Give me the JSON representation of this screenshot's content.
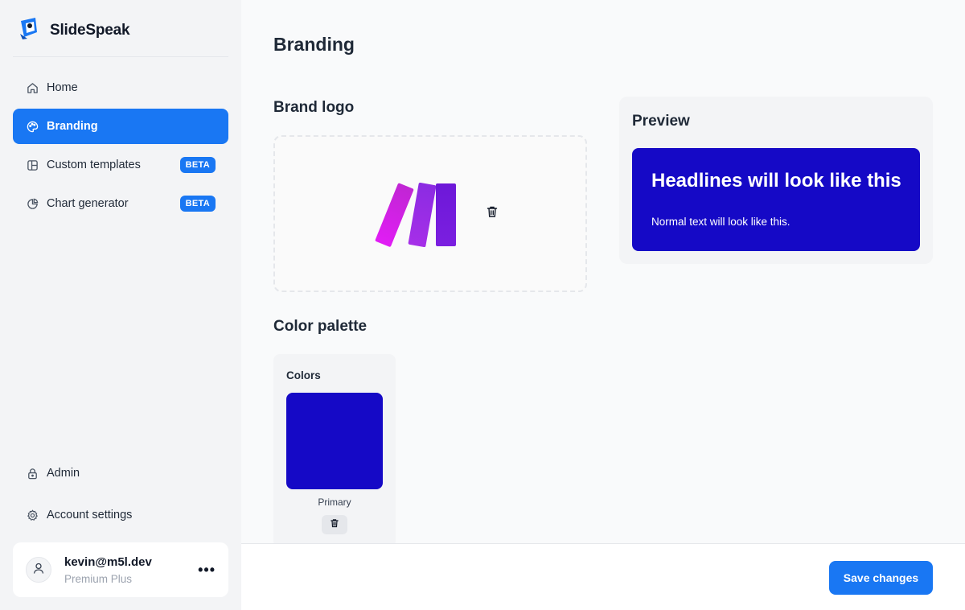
{
  "app": {
    "name": "SlideSpeak"
  },
  "sidebar": {
    "items": [
      {
        "label": "Home",
        "icon": "home-icon"
      },
      {
        "label": "Branding",
        "icon": "palette-icon",
        "active": true
      },
      {
        "label": "Custom templates",
        "icon": "template-icon",
        "badge": "BETA"
      },
      {
        "label": "Chart generator",
        "icon": "pie-chart-icon",
        "badge": "BETA"
      }
    ],
    "bottom_items": [
      {
        "label": "Admin",
        "icon": "lock-icon"
      },
      {
        "label": "Account settings",
        "icon": "gear-icon"
      }
    ],
    "user": {
      "email": "kevin@m5l.dev",
      "plan": "Premium Plus",
      "more": "•••"
    }
  },
  "main": {
    "title": "Branding",
    "brand_logo": {
      "title": "Brand logo"
    },
    "preview": {
      "title": "Preview",
      "headline": "Headlines will look like this",
      "text": "Normal text will look like this."
    },
    "color_palette": {
      "title": "Color palette",
      "label": "Colors",
      "colors": [
        {
          "name": "Primary",
          "hex": "#1509c6"
        }
      ]
    },
    "footer": {
      "save_label": "Save changes"
    }
  },
  "theme": {
    "accent": "#1977f3",
    "brand_primary": "#1509c6"
  }
}
